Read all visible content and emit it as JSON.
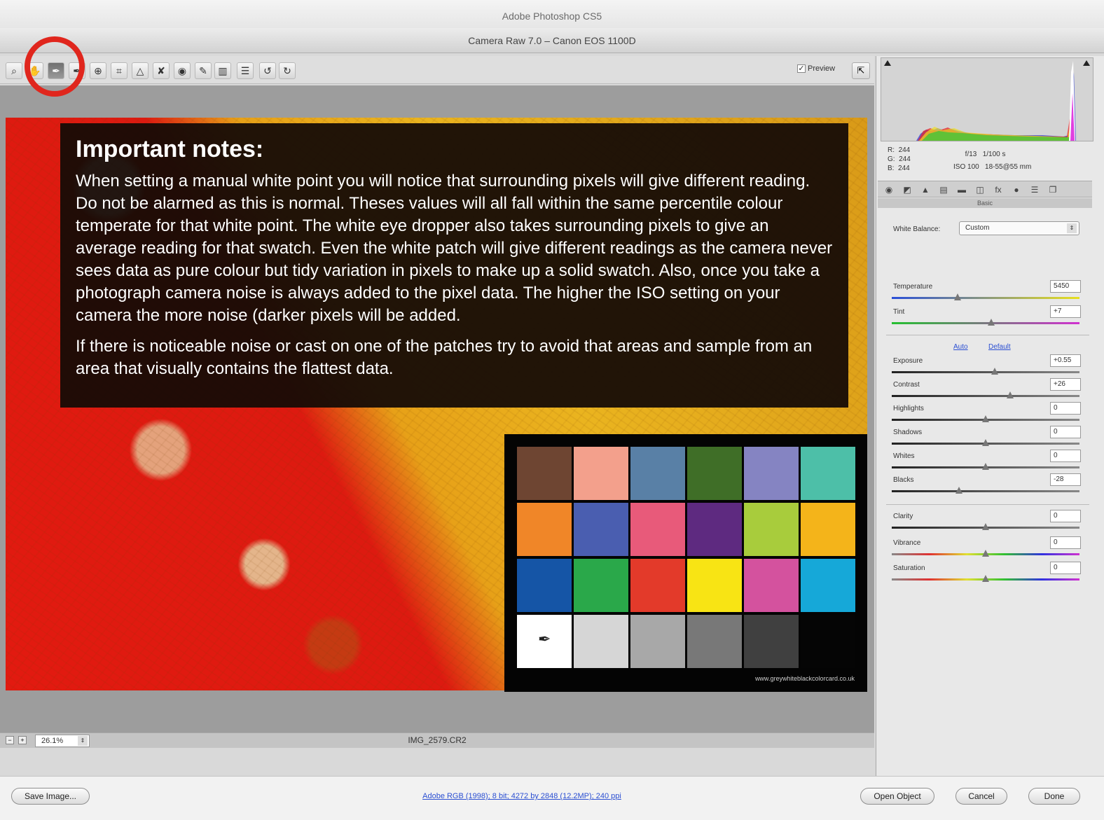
{
  "app_title": "Adobe Photoshop CS5",
  "window_title": "Camera Raw 7.0  –  Canon EOS 1100D",
  "toolbar": {
    "tools": [
      {
        "name": "zoom-tool",
        "icon": "magnifier-icon",
        "glyph": "⌕"
      },
      {
        "name": "hand-tool",
        "icon": "hand-icon",
        "glyph": "✋"
      },
      {
        "name": "white-balance-tool",
        "icon": "eyedropper-icon",
        "glyph": "✒",
        "active": true
      },
      {
        "name": "color-sampler-tool",
        "icon": "color-sampler-icon",
        "glyph": "✒"
      },
      {
        "name": "targeted-adjustment-tool",
        "icon": "target-icon",
        "glyph": "⊕"
      },
      {
        "name": "crop-tool",
        "icon": "crop-icon",
        "glyph": "⌗"
      },
      {
        "name": "straighten-tool",
        "icon": "straighten-icon",
        "glyph": "△"
      },
      {
        "name": "spot-removal-tool",
        "icon": "spot-removal-icon",
        "glyph": "✘"
      },
      {
        "name": "red-eye-tool",
        "icon": "red-eye-icon",
        "glyph": "◉"
      },
      {
        "name": "adjustment-brush-tool",
        "icon": "brush-icon",
        "glyph": "✎"
      },
      {
        "name": "graduated-filter-tool",
        "icon": "graduated-filter-icon",
        "glyph": "▥"
      },
      {
        "name": "preferences-tool",
        "icon": "preferences-icon",
        "glyph": "☰"
      },
      {
        "name": "rotate-left-tool",
        "icon": "rotate-ccw-icon",
        "glyph": "↺"
      },
      {
        "name": "rotate-right-tool",
        "icon": "rotate-cw-icon",
        "glyph": "↻"
      }
    ],
    "preview_label": "Preview",
    "preview_checked": true
  },
  "notes": {
    "heading": "Important notes:",
    "paragraph1": "When setting a manual white point you will notice that surrounding pixels will give different reading. Do not be alarmed as this is normal. Theses values will all fall within the same percentile colour temperate for that white point. The white eye dropper  also takes surrounding pixels to give an average reading for that swatch. Even the white patch will give different readings as the camera never sees data as pure colour but  tidy variation  in pixels to make up a solid swatch. Also, once you take a photograph camera noise is always added to the pixel data. The higher the ISO setting on your camera the more noise (darker pixels will be added.",
    "paragraph2": "If there is noticeable noise or cast on one of the patches try to avoid  that areas and sample from an area that visually contains the flattest data."
  },
  "colorchecker": {
    "patches": [
      "#6e4532",
      "#f3a08c",
      "#5980a6",
      "#3f6e27",
      "#8584c2",
      "#4dbfa8",
      "#f08628",
      "#4a5eb0",
      "#e85a7a",
      "#5e2a80",
      "#a8cc3c",
      "#f4b41a",
      "#1555a6",
      "#2aa84a",
      "#e33a2a",
      "#f8e414",
      "#d4529e",
      "#16a8d8",
      "#ffffff",
      "#d6d6d6",
      "#a8a8a8",
      "#787878",
      "#404040",
      "#050505"
    ],
    "url": "www.greywhiteblackcolorcard.co.uk"
  },
  "status": {
    "zoom": "26.1%",
    "filename": "IMG_2579.CR2"
  },
  "info": {
    "r_label": "R:",
    "r_value": "244",
    "g_label": "G:",
    "g_value": "244",
    "b_label": "B:",
    "b_value": "244",
    "aperture": "f/13",
    "shutter": "1/100 s",
    "iso": "ISO 100",
    "lens": "18-55@55 mm"
  },
  "basic_panel": {
    "title": "Basic",
    "white_balance_label": "White Balance:",
    "white_balance_value": "Custom",
    "auto_label": "Auto",
    "default_label": "Default",
    "sliders": [
      {
        "id": "temperature",
        "label": "Temperature",
        "value": "5450",
        "position": 0.35,
        "track": "temp"
      },
      {
        "id": "tint",
        "label": "Tint",
        "value": "+7",
        "position": 0.53,
        "track": "tint"
      },
      {
        "id": "exposure",
        "label": "Exposure",
        "value": "+0.55",
        "position": 0.55,
        "track": "gray"
      },
      {
        "id": "contrast",
        "label": "Contrast",
        "value": "+26",
        "position": 0.63,
        "track": "gray"
      },
      {
        "id": "highlights",
        "label": "Highlights",
        "value": "0",
        "position": 0.5,
        "track": "gray"
      },
      {
        "id": "shadows",
        "label": "Shadows",
        "value": "0",
        "position": 0.5,
        "track": "gray"
      },
      {
        "id": "whites",
        "label": "Whites",
        "value": "0",
        "position": 0.5,
        "track": "gray"
      },
      {
        "id": "blacks",
        "label": "Blacks",
        "value": "-28",
        "position": 0.36,
        "track": "gray"
      },
      {
        "id": "clarity",
        "label": "Clarity",
        "value": "0",
        "position": 0.5,
        "track": "gray"
      },
      {
        "id": "vibrance",
        "label": "Vibrance",
        "value": "0",
        "position": 0.5,
        "track": "color"
      },
      {
        "id": "saturation",
        "label": "Saturation",
        "value": "0",
        "position": 0.5,
        "track": "color"
      }
    ]
  },
  "footer": {
    "save_label": "Save Image...",
    "workflow_link": "Adobe RGB (1998); 8 bit; 4272 by 2848 (12.2MP); 240 ppi",
    "open_label": "Open Object",
    "cancel_label": "Cancel",
    "done_label": "Done"
  },
  "colors": {
    "highlight_circle": "#e0261d",
    "link": "#2b4fd2"
  }
}
